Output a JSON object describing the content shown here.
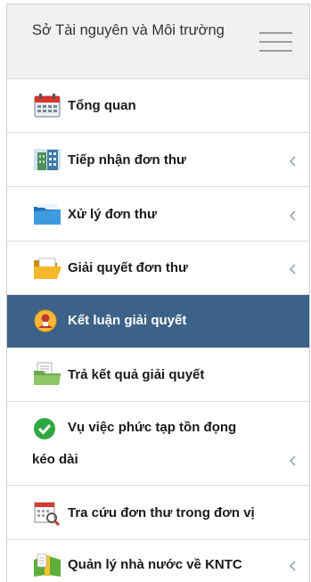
{
  "header": {
    "title": "Sở Tài nguyên và Môi trường",
    "menu_icon": "hamburger-icon"
  },
  "menu": {
    "items": [
      {
        "label": "Tổng quan",
        "icon": "calendar-icon",
        "has_submenu": false,
        "active": false
      },
      {
        "label": "Tiếp nhận đơn thư",
        "icon": "building-icon",
        "has_submenu": true,
        "active": false
      },
      {
        "label": "Xử lý đơn thư",
        "icon": "blue-folder-icon",
        "has_submenu": true,
        "active": false
      },
      {
        "label": "Giải quyết đơn thư",
        "icon": "open-folder-icon",
        "has_submenu": true,
        "active": false
      },
      {
        "label": "Kết luận giải quyết",
        "icon": "user-badge-icon",
        "has_submenu": false,
        "active": true
      },
      {
        "label": "Trả kết quả giải quyết",
        "icon": "folder-documents-icon",
        "has_submenu": false,
        "active": false
      },
      {
        "label": "Vụ việc phức tạp tồn đọng",
        "label_line2": "kéo dài",
        "icon": "check-circle-icon",
        "has_submenu": true,
        "active": false
      },
      {
        "label": "Tra cứu đơn thư trong đơn vị",
        "icon": "calendar-search-icon",
        "has_submenu": false,
        "active": false
      },
      {
        "label": "Quản lý nhà nước về KNTC",
        "icon": "book-icon",
        "has_submenu": true,
        "active": false
      }
    ]
  },
  "colors": {
    "active_background": "#3d6287",
    "header_background": "#f1f1f1",
    "chevron": "#9aa6b2"
  }
}
